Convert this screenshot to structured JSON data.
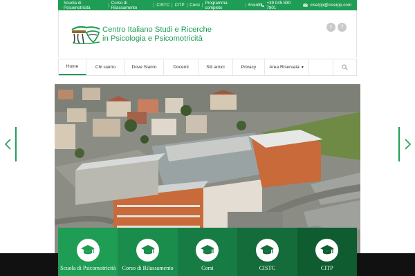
{
  "topbar": {
    "links": [
      "Scuola di Psicomotricità",
      "Corso di Rilassamento",
      "CISTC",
      "CITP",
      "Corsi",
      "Programma completo",
      "Eventi"
    ],
    "phone": "+39 045 830 7801",
    "email": "ciserpp@ciserpp.com"
  },
  "header": {
    "brand_line1": "Centro Italiano Studi e Ricerche",
    "brand_line2": "in Psicologia e Psicomotricità",
    "social": [
      "t",
      "f"
    ]
  },
  "nav": {
    "items": [
      "Home",
      "Chi siamo",
      "Dove Siamo",
      "Docenti",
      "Siti amici",
      "Privacy",
      "Area Riservata"
    ]
  },
  "tiles": [
    {
      "label": "Scuola di Psicomotricità",
      "color": "#1f9d55"
    },
    {
      "label": "Corso di Rilassamento",
      "color": "#1a8c4b"
    },
    {
      "label": "Corsi",
      "color": "#177c43"
    },
    {
      "label": "CISTC",
      "color": "#136c3a"
    },
    {
      "label": "CITP",
      "color": "#0f5c31"
    }
  ],
  "colors": {
    "accent": "#1f9d55",
    "dark": "#111111"
  }
}
